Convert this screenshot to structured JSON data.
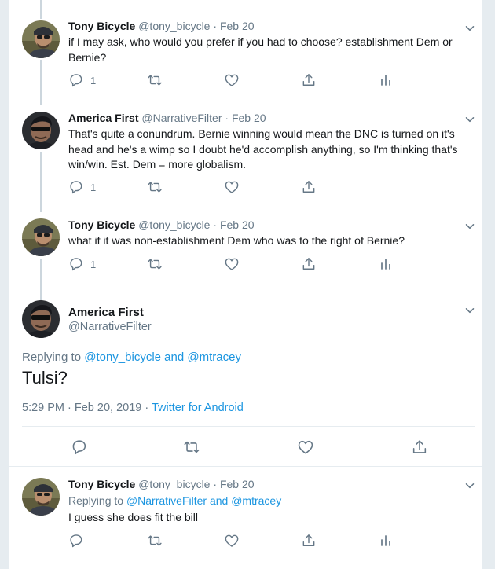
{
  "tweets": [
    {
      "name": "Tony Bicycle",
      "handle": "@tony_bicycle",
      "date": "Feb 20",
      "text": "if I may ask, who would you prefer if you had to choose? establishment Dem or Bernie?",
      "reply_count": "1"
    },
    {
      "name": "America First",
      "handle": "@NarrativeFilter",
      "date": "Feb 20",
      "text": "That's quite a conundrum.  Bernie winning would mean the DNC is turned on it's head and he's a wimp so I doubt he'd accomplish anything, so I'm thinking that's win/win. Est. Dem = more globalism.",
      "reply_count": "1"
    },
    {
      "name": "Tony Bicycle",
      "handle": "@tony_bicycle",
      "date": "Feb 20",
      "text": "what if it was non-establishment Dem who was to the right of Bernie?",
      "reply_count": "1"
    }
  ],
  "main_tweet": {
    "name": "America First",
    "handle": "@NarrativeFilter",
    "replying_prefix": "Replying to",
    "replying_user1": "@tony_bicycle",
    "replying_and": "and",
    "replying_user2": "@mtracey",
    "text": "Tulsi?",
    "time": "5:29 PM · Feb 20, 2019 ·",
    "source": "Twitter for Android"
  },
  "reply_tweet": {
    "name": "Tony Bicycle",
    "handle": "@tony_bicycle",
    "date": "Feb 20",
    "replying_prefix": "Replying to",
    "replying_user1": "@NarrativeFilter",
    "replying_and": "and",
    "replying_user2": "@mtracey",
    "text": "I guess she does fit the bill"
  },
  "separator": "·",
  "colors": {
    "link": "#1b95e0",
    "muted": "#657786",
    "text": "#14171a",
    "line": "#e6ecf0"
  },
  "icons": [
    "reply-icon",
    "retweet-icon",
    "like-icon",
    "share-icon",
    "analytics-icon",
    "chevron-down-icon"
  ]
}
